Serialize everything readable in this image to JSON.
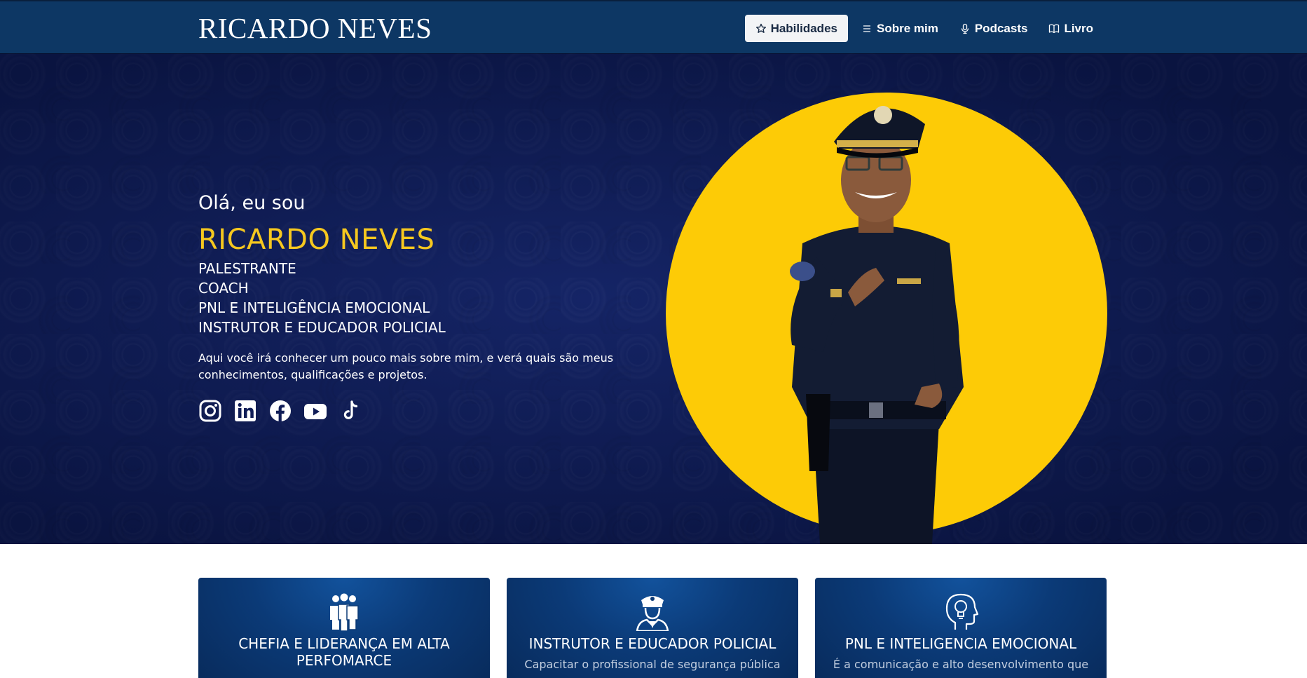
{
  "navbar": {
    "brand": "RICARDO NEVES",
    "items": [
      {
        "label": "Habilidades",
        "icon": "star-icon",
        "active": true
      },
      {
        "label": "Sobre mim",
        "icon": "list-icon",
        "active": false
      },
      {
        "label": "Podcasts",
        "icon": "microphone-icon",
        "active": false
      },
      {
        "label": "Livro",
        "icon": "book-icon",
        "active": false
      }
    ]
  },
  "hero": {
    "greeting": "Olá, eu sou",
    "name": "RICARDO NEVES",
    "roles": [
      "PALESTRANTE",
      "COACH",
      "PNL E INTELIGÊNCIA EMOCIONAL",
      "INSTRUTOR E EDUCADOR POLICIAL"
    ],
    "intro": "Aqui você irá conhecer um pouco mais sobre mim, e verá quais são meus conhecimentos, qualificações e projetos.",
    "socials": [
      "instagram-icon",
      "linkedin-icon",
      "facebook-icon",
      "youtube-icon",
      "tiktok-icon"
    ]
  },
  "cards": [
    {
      "icon": "team-icon",
      "title": "CHEFIA E LIDERANÇA EM ALTA PERFOMARCE",
      "desc": ""
    },
    {
      "icon": "police-officer-icon",
      "title": "INSTRUTOR E EDUCADOR POLICIAL",
      "desc": "Capacitar o profissional de segurança pública"
    },
    {
      "icon": "head-lightbulb-icon",
      "title": "PNL E INTELIGENCIA EMOCIONAL",
      "desc": "É a comunicação e alto desenvolvimento que"
    }
  ],
  "colors": {
    "navbar": "#0d3764",
    "hero_bg": "#101d57",
    "accent_yellow": "#f6c81f",
    "circle_yellow": "#fdcb06",
    "card_bg": "#0b3a77"
  }
}
